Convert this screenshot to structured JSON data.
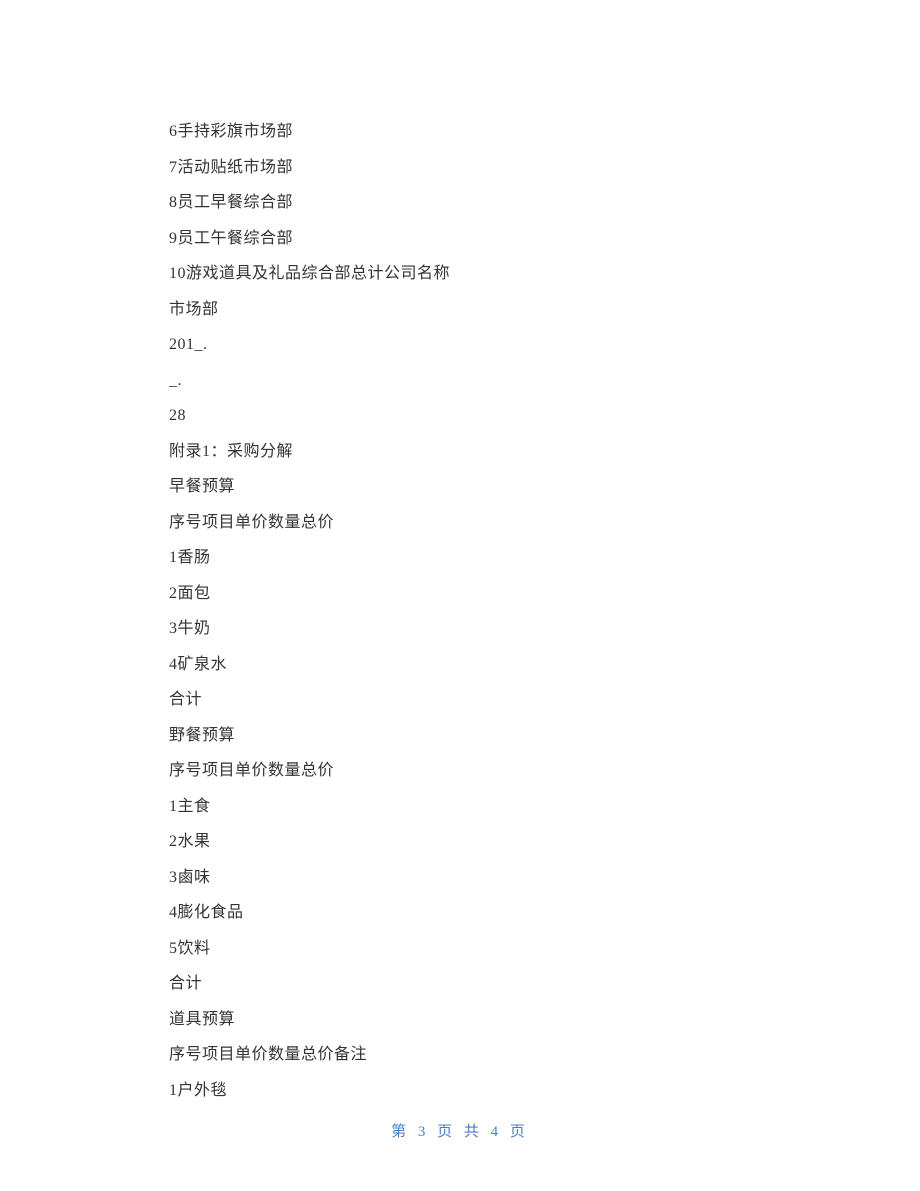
{
  "lines": [
    "6手持彩旗市场部",
    "7活动贴纸市场部",
    "8员工早餐综合部",
    "9员工午餐综合部",
    "10游戏道具及礼品综合部总计公司名称",
    "市场部",
    "201_.",
    "_.",
    "28",
    "附录1：采购分解",
    "早餐预算",
    "序号项目单价数量总价",
    "1香肠",
    "2面包",
    "3牛奶",
    "4矿泉水",
    "合计",
    "野餐预算",
    "序号项目单价数量总价",
    "1主食",
    "2水果",
    "3鹵味",
    "4膨化食品",
    "5饮料",
    "合计",
    "道具预算",
    "序号项目单价数量总价备注",
    "1户外毯"
  ],
  "footer": "第 3 页 共 4 页"
}
